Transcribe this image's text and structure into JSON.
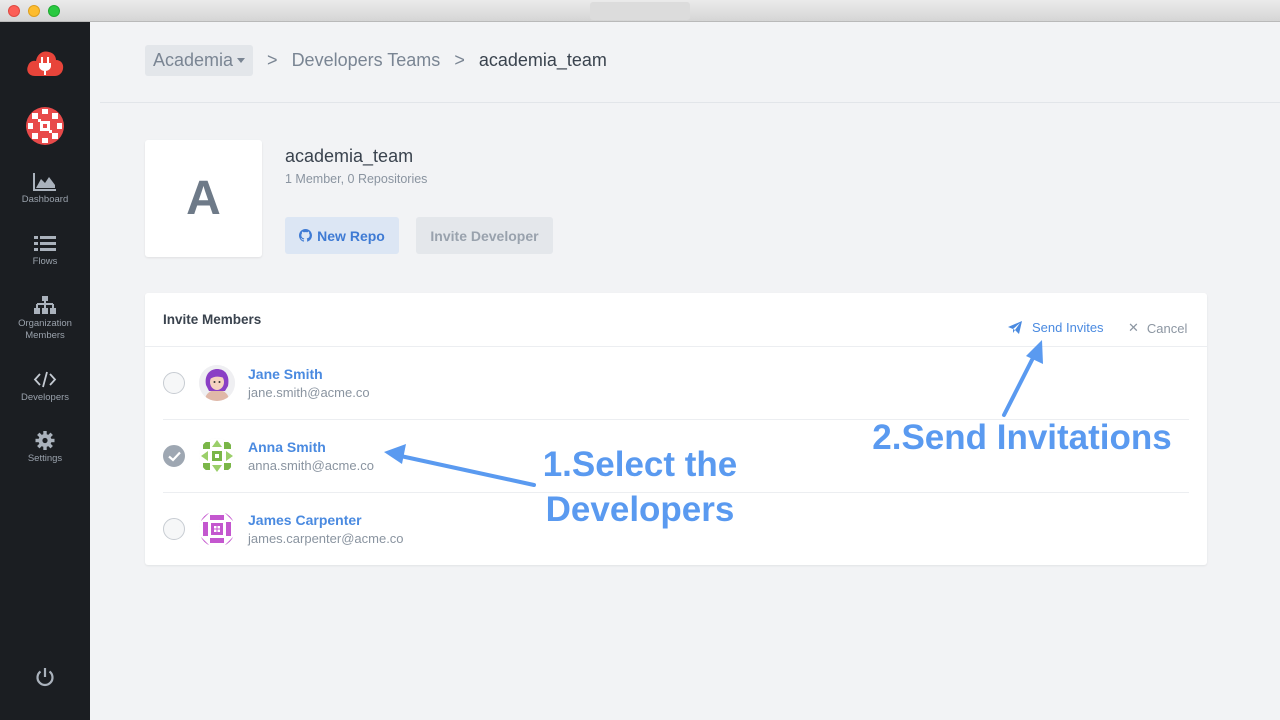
{
  "sidebar": {
    "items": [
      {
        "label": "Dashboard",
        "icon": "area-chart-icon"
      },
      {
        "label": "Flows",
        "icon": "list-icon"
      },
      {
        "label": "Organization Members",
        "icon": "sitemap-icon"
      },
      {
        "label": "Developers",
        "icon": "code-icon"
      },
      {
        "label": "Settings",
        "icon": "gear-icon"
      }
    ]
  },
  "breadcrumb": {
    "org": "Academia",
    "sep1": ">",
    "section": "Developers Teams",
    "sep2": ">",
    "current": "academia_team"
  },
  "team": {
    "initial": "A",
    "name": "academia_team",
    "meta": "1 Member, 0 Repositories",
    "new_repo_label": "New Repo",
    "invite_label": "Invite Developer"
  },
  "invite": {
    "title": "Invite Members",
    "send_label": "Send Invites",
    "cancel_label": "Cancel",
    "members": [
      {
        "name": "Jane Smith",
        "email": "jane.smith@acme.co",
        "selected": false
      },
      {
        "name": "Anna Smith",
        "email": "anna.smith@acme.co",
        "selected": true
      },
      {
        "name": "James Carpenter",
        "email": "james.carpenter@acme.co",
        "selected": false
      }
    ]
  },
  "annotations": {
    "step1_line1": "1.Select the",
    "step1_line2": "Developers",
    "step2": "2.Send Invitations"
  },
  "colors": {
    "accent": "#4a8ae0",
    "annotation": "#5a9af0",
    "sidebar_bg": "#1b1e22",
    "brand_red": "#e8443a"
  }
}
